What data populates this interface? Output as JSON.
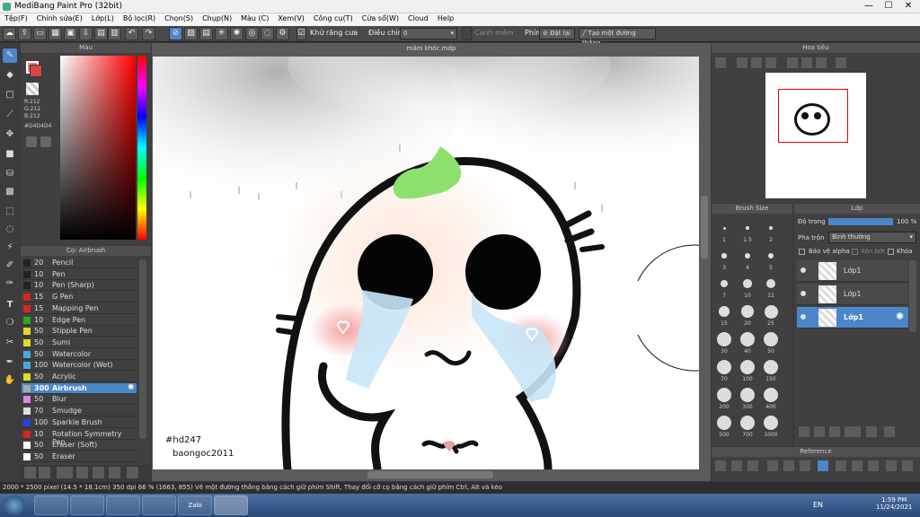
{
  "window": {
    "title": "MediBang Paint Pro (32bit)",
    "min": "—",
    "max": "☐",
    "close": "✕"
  },
  "menu": [
    "Tệp(F)",
    "Chỉnh sửa(E)",
    "Lớp(L)",
    "Bộ lọc(R)",
    "Chọn(S)",
    "Chụp(N)",
    "Màu (C)",
    "Xem(V)",
    "Công cụ(T)",
    "Cửa sổ(W)",
    "Cloud",
    "Help"
  ],
  "toolbar": {
    "antialias_label": "Khử răng cưa",
    "adjust_label": "Điều chỉnh",
    "adjust_value": "0",
    "smooth_label": "Cạnh mềm",
    "key_label": "Phím",
    "reset_label": "Đặt lại",
    "line_label": "Tạo một đường thẳng"
  },
  "color_panel": {
    "title": "Màu",
    "r": "R:212",
    "g": "G:212",
    "b": "B:212",
    "hex": "#D4D4D4"
  },
  "brush_panel": {
    "title": "Cọ: Airbrush",
    "items": [
      {
        "size": "20",
        "name": "Pencil",
        "color": "#222222"
      },
      {
        "size": "10",
        "name": "Pen",
        "color": "#222222"
      },
      {
        "size": "10",
        "name": "Pen (Sharp)",
        "color": "#222222"
      },
      {
        "size": "15",
        "name": "G Pen",
        "color": "#dd2222"
      },
      {
        "size": "15",
        "name": "Mapping Pen",
        "color": "#dd2222"
      },
      {
        "size": "10",
        "name": "Edge Pen",
        "color": "#22aa22"
      },
      {
        "size": "50",
        "name": "Stipple Pen",
        "color": "#dddd22"
      },
      {
        "size": "50",
        "name": "Sumi",
        "color": "#dddd22"
      },
      {
        "size": "50",
        "name": "Watercolor",
        "color": "#44aadd"
      },
      {
        "size": "100",
        "name": "Watercolor (Wet)",
        "color": "#44aadd"
      },
      {
        "size": "50",
        "name": "Acrylic",
        "color": "#dddd22"
      },
      {
        "size": "300",
        "name": "Airbrush",
        "color": "#aaaaaa"
      },
      {
        "size": "50",
        "name": "Blur",
        "color": "#dd88dd"
      },
      {
        "size": "70",
        "name": "Smudge",
        "color": "#dddddd"
      },
      {
        "size": "100",
        "name": "Sparkle Brush",
        "color": "#2244dd"
      },
      {
        "size": "10",
        "name": "Rotation Symmetry Pen",
        "color": "#dd2222"
      },
      {
        "size": "50",
        "name": "Eraser (Soft)",
        "color": "#ffffff"
      },
      {
        "size": "50",
        "name": "Eraser",
        "color": "#ffffff"
      }
    ]
  },
  "canvas": {
    "tab_title": "mâm khóc.mdp",
    "watermark1": "#hd247",
    "watermark2": "baongoc2011"
  },
  "navigator": {
    "title": "Hoa tiêu"
  },
  "brush_size": {
    "title": "Brush Size",
    "sizes": [
      "1",
      "1.5",
      "2",
      "3",
      "4",
      "5",
      "7",
      "10",
      "12",
      "15",
      "20",
      "25",
      "30",
      "40",
      "50",
      "70",
      "100",
      "150",
      "200",
      "300",
      "400",
      "500",
      "700",
      "1000"
    ]
  },
  "layer_panel": {
    "title": "Lớp",
    "opacity_label": "Độ trong",
    "opacity_value": "100 %",
    "opacity": 1.0,
    "blend_label": "Pha trộn",
    "blend_value": "Bình thường",
    "protect_alpha": "Bảo vệ alpha",
    "clipping": "Xén bớt",
    "lock": "Khóa",
    "layers": [
      "Lớp1",
      "Lớp1",
      "Lớp1"
    ]
  },
  "reference": {
    "title": "Reference"
  },
  "status": "2000 * 2500 pixel   (14.5 * 18.1cm)   350 dpi   66 %   (1663, 855)   Vẽ một đường thẳng bằng cách giữ phím Shift, Thay đổi cỡ cọ bằng cách giữ phím Ctrl, Alt và kéo",
  "taskbar": {
    "lang": "EN",
    "time": "1:59 PM",
    "date": "11/24/2021",
    "zalo": "Zalo"
  }
}
